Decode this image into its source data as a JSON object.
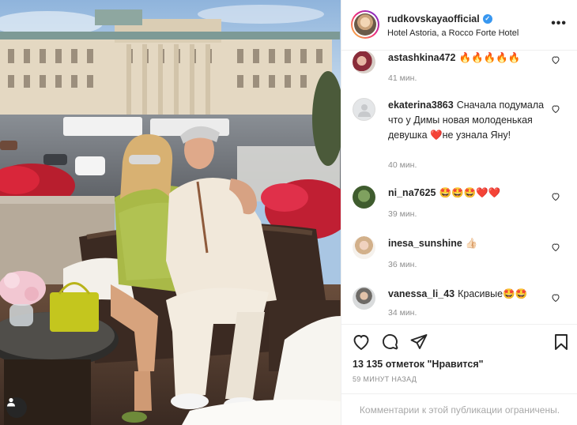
{
  "post": {
    "username": "rudkovskayaofficial",
    "location": "Hotel Astoria, a Rocco Forte Hotel",
    "likes_text": "13 135 отметок \"Нравится\"",
    "time_ago": "59 МИНУТ НАЗАД",
    "comments_restricted": "Комментарии к этой публикации ограничены."
  },
  "comments": [
    {
      "user": "astashkina472",
      "text": "🔥🔥🔥🔥🔥",
      "time": "41 мин."
    },
    {
      "user": "ekaterina3863",
      "text": "Сначала подумала что у Димы новая молоденькая девушка ❤️не узнала Яну!",
      "time": "40 мин."
    },
    {
      "user": "ni_na7625",
      "text": "🤩🤩🤩❤️❤️",
      "time": "39 мин."
    },
    {
      "user": "inesa_sunshine",
      "text": "👍🏻",
      "time": "36 мин."
    },
    {
      "user": "vanessa_li_43",
      "text": "Красивые🤩🤩",
      "time": "34 мин."
    }
  ],
  "icons": [
    "heart-icon",
    "comment-icon",
    "share-icon",
    "bookmark-icon",
    "tag-user-icon",
    "more-options-icon",
    "verified-badge-icon"
  ],
  "colors": {
    "verified": "#3897f0",
    "muted": "#8e8e8e",
    "border": "#efefef"
  }
}
